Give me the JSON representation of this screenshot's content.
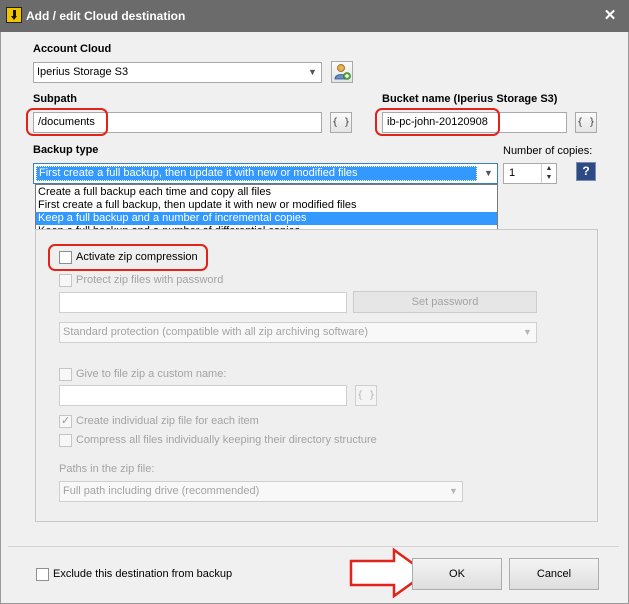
{
  "window": {
    "title": "Add / edit Cloud destination",
    "close_glyph": "✕"
  },
  "account": {
    "label": "Account Cloud",
    "value": "Iperius Storage S3"
  },
  "subpath": {
    "label": "Subpath",
    "value": "/documents",
    "brace_glyph": "{ }"
  },
  "bucket": {
    "label": "Bucket name (Iperius Storage S3)",
    "value": "ib-pc-john-20120908",
    "brace_glyph": "{ }"
  },
  "backup_type": {
    "label": "Backup type",
    "value": "First create a full backup, then update it with new or modified files",
    "options": [
      "Create a full backup each time and copy all files",
      "First create a full backup, then update it with new or modified files",
      "Keep a full backup and a number of incremental copies",
      "Keep a full backup and a number of differential copies"
    ],
    "highlighted_index": 2
  },
  "copies": {
    "label": "Number of copies:",
    "value": "1"
  },
  "help": {
    "glyph": "?"
  },
  "zip": {
    "activate_label": "Activate zip compression",
    "protect_label": "Protect zip files with password",
    "set_password_label": "Set password",
    "protection_value": "Standard protection (compatible with all zip archiving software)",
    "custom_name_label": "Give to file zip a custom name:",
    "brace_glyph": "{ }",
    "individual_label": "Create individual zip file for each item",
    "compress_all_label": "Compress all files individually keeping their directory structure",
    "paths_label": "Paths in the zip file:",
    "paths_value": "Full path including drive (recommended)"
  },
  "footer": {
    "exclude_label": "Exclude this destination from backup",
    "ok_label": "OK",
    "cancel_label": "Cancel"
  },
  "colors": {
    "highlight": "#e0231b",
    "selection": "#3399ff",
    "titlebar": "#6b6b6b"
  }
}
